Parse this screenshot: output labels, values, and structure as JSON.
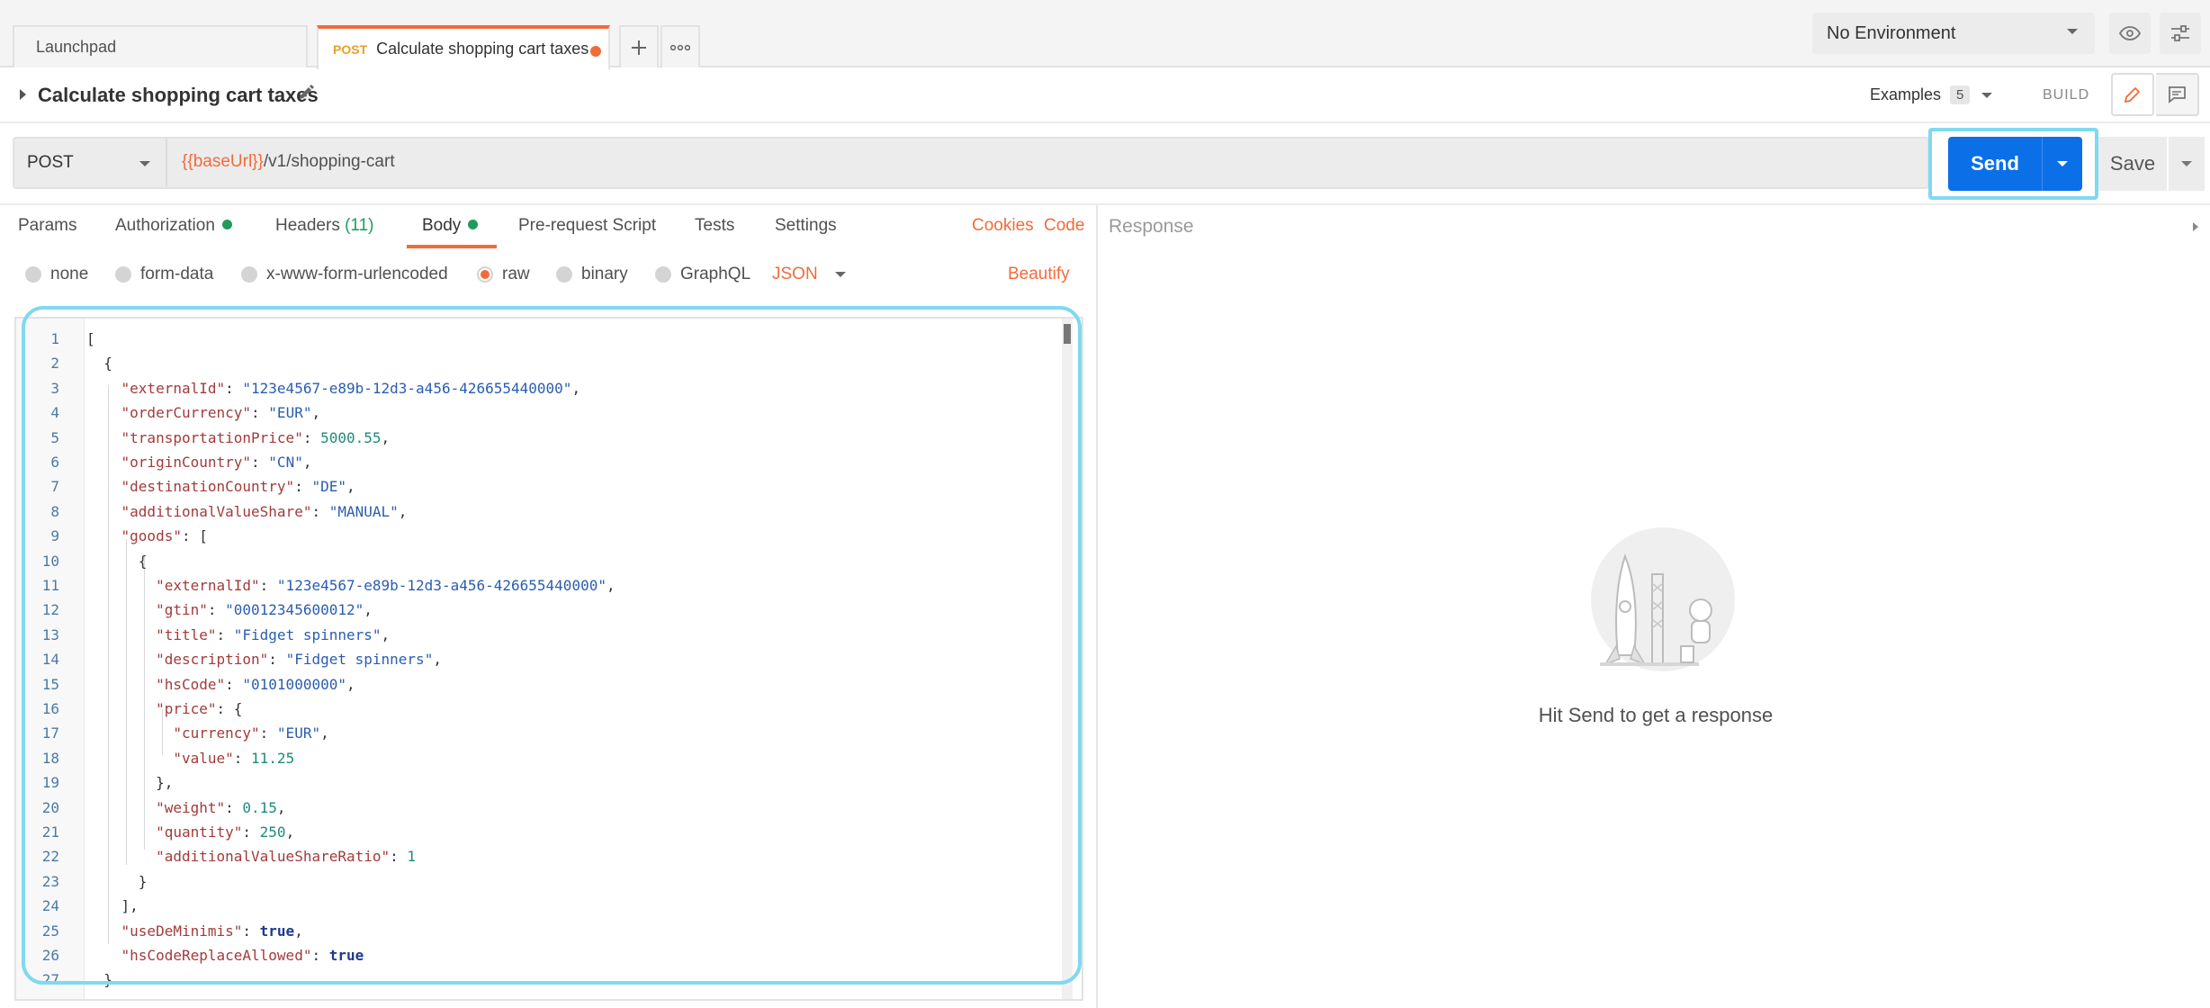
{
  "tabs": {
    "launchpad": "Launchpad",
    "active_method": "POST",
    "active_title": "Calculate shopping cart taxes"
  },
  "environment": {
    "selected": "No Environment"
  },
  "request": {
    "name": "Calculate shopping cart taxes",
    "examples_label": "Examples",
    "examples_count": "5",
    "build_label": "BUILD",
    "method": "POST",
    "url_var": "{{baseUrl}}",
    "url_path": "/v1/shopping-cart",
    "send_label": "Send",
    "save_label": "Save"
  },
  "request_tabs": {
    "params": "Params",
    "authorization": "Authorization",
    "headers": "Headers",
    "headers_count": "(11)",
    "body": "Body",
    "prerequest": "Pre-request Script",
    "tests": "Tests",
    "settings": "Settings",
    "cookies": "Cookies",
    "code": "Code"
  },
  "body_types": {
    "none": "none",
    "form_data": "form-data",
    "urlencoded": "x-www-form-urlencoded",
    "raw": "raw",
    "binary": "binary",
    "graphql": "GraphQL",
    "language": "JSON",
    "beautify": "Beautify"
  },
  "code_lines": [
    "[",
    "  {",
    "    \"externalId\": \"123e4567-e89b-12d3-a456-426655440000\",",
    "    \"orderCurrency\": \"EUR\",",
    "    \"transportationPrice\": 5000.55,",
    "    \"originCountry\": \"CN\",",
    "    \"destinationCountry\": \"DE\",",
    "    \"additionalValueShare\": \"MANUAL\",",
    "    \"goods\": [",
    "      {",
    "        \"externalId\": \"123e4567-e89b-12d3-a456-426655440000\",",
    "        \"gtin\": \"00012345600012\",",
    "        \"title\": \"Fidget spinners\",",
    "        \"description\": \"Fidget spinners\",",
    "        \"hsCode\": \"0101000000\",",
    "        \"price\": {",
    "          \"currency\": \"EUR\",",
    "          \"value\": 11.25",
    "        },",
    "        \"weight\": 0.15,",
    "        \"quantity\": 250,",
    "        \"additionalValueShareRatio\": 1",
    "      }",
    "    ],",
    "    \"useDeMinimis\": true,",
    "    \"hsCodeReplaceAllowed\": true",
    "  }",
    "]"
  ],
  "response": {
    "title": "Response",
    "hint": "Hit Send to get a response"
  },
  "colors": {
    "accent": "#f26b3a",
    "send": "#0b6fe8",
    "highlight": "#7fd9ef",
    "status_dot": "#1e9c5a"
  },
  "icons": [
    "plus-icon",
    "more-icon",
    "chevron-down-icon",
    "eye-icon",
    "sliders-icon",
    "caret-right-icon",
    "pencil-icon",
    "comment-icon",
    "rocket-illustration"
  ]
}
